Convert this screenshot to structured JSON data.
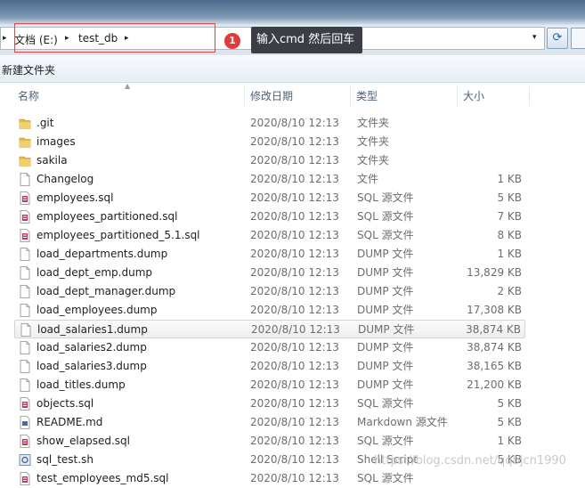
{
  "address": {
    "crumbs": [
      "文档 (E:)",
      "test_db"
    ],
    "separator": "▸",
    "dropdown_glyph": "▾",
    "refresh_glyph": "⟳"
  },
  "annotation": {
    "number": "1",
    "text": "输入cmd 然后回车"
  },
  "toolbar": {
    "new_folder_label": "新建文件夹"
  },
  "columns": {
    "name": "名称",
    "date": "修改日期",
    "type": "类型",
    "size": "大小"
  },
  "files": [
    {
      "name": ".git",
      "date": "2020/8/10 12:13",
      "type": "文件夹",
      "size": "",
      "icon": "folder-icon"
    },
    {
      "name": "images",
      "date": "2020/8/10 12:13",
      "type": "文件夹",
      "size": "",
      "icon": "folder-icon"
    },
    {
      "name": "sakila",
      "date": "2020/8/10 12:13",
      "type": "文件夹",
      "size": "",
      "icon": "folder-icon"
    },
    {
      "name": "Changelog",
      "date": "2020/8/10 12:13",
      "type": "文件",
      "size": "1 KB",
      "icon": "file-icon"
    },
    {
      "name": "employees.sql",
      "date": "2020/8/10 12:13",
      "type": "SQL 源文件",
      "size": "5 KB",
      "icon": "sql-file-icon"
    },
    {
      "name": "employees_partitioned.sql",
      "date": "2020/8/10 12:13",
      "type": "SQL 源文件",
      "size": "7 KB",
      "icon": "sql-file-icon"
    },
    {
      "name": "employees_partitioned_5.1.sql",
      "date": "2020/8/10 12:13",
      "type": "SQL 源文件",
      "size": "8 KB",
      "icon": "sql-file-icon"
    },
    {
      "name": "load_departments.dump",
      "date": "2020/8/10 12:13",
      "type": "DUMP 文件",
      "size": "1 KB",
      "icon": "file-icon"
    },
    {
      "name": "load_dept_emp.dump",
      "date": "2020/8/10 12:13",
      "type": "DUMP 文件",
      "size": "13,829 KB",
      "icon": "file-icon"
    },
    {
      "name": "load_dept_manager.dump",
      "date": "2020/8/10 12:13",
      "type": "DUMP 文件",
      "size": "2 KB",
      "icon": "file-icon"
    },
    {
      "name": "load_employees.dump",
      "date": "2020/8/10 12:13",
      "type": "DUMP 文件",
      "size": "17,308 KB",
      "icon": "file-icon"
    },
    {
      "name": "load_salaries1.dump",
      "date": "2020/8/10 12:13",
      "type": "DUMP 文件",
      "size": "38,874 KB",
      "icon": "file-icon",
      "selected": true
    },
    {
      "name": "load_salaries2.dump",
      "date": "2020/8/10 12:13",
      "type": "DUMP 文件",
      "size": "38,874 KB",
      "icon": "file-icon"
    },
    {
      "name": "load_salaries3.dump",
      "date": "2020/8/10 12:13",
      "type": "DUMP 文件",
      "size": "38,165 KB",
      "icon": "file-icon"
    },
    {
      "name": "load_titles.dump",
      "date": "2020/8/10 12:13",
      "type": "DUMP 文件",
      "size": "21,200 KB",
      "icon": "file-icon"
    },
    {
      "name": "objects.sql",
      "date": "2020/8/10 12:13",
      "type": "SQL 源文件",
      "size": "5 KB",
      "icon": "sql-file-icon"
    },
    {
      "name": "README.md",
      "date": "2020/8/10 12:13",
      "type": "Markdown 源文件",
      "size": "5 KB",
      "icon": "markdown-file-icon"
    },
    {
      "name": "show_elapsed.sql",
      "date": "2020/8/10 12:13",
      "type": "SQL 源文件",
      "size": "1 KB",
      "icon": "sql-file-icon"
    },
    {
      "name": "sql_test.sh",
      "date": "2020/8/10 12:13",
      "type": "Shell Script",
      "size": "5 KB",
      "icon": "shell-script-icon"
    },
    {
      "name": "test_employees_md5.sql",
      "date": "2020/8/10 12:13",
      "type": "SQL 源文件",
      "size": "",
      "icon": "sql-file-icon"
    }
  ],
  "watermark": "https://blog.csdn.net/qqbjcn1990",
  "colors": {
    "folder": "#e8b84a",
    "sql_accent": "#d0305a",
    "annotation_red": "#e23a3a",
    "selection_border": "#d4d4d4"
  }
}
